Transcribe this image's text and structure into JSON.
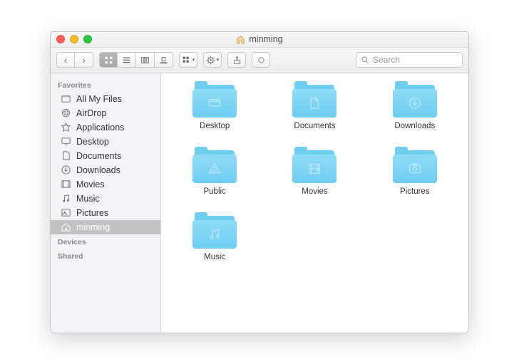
{
  "window": {
    "title": "minming"
  },
  "toolbar": {
    "search_placeholder": "Search"
  },
  "sidebar": {
    "sections": {
      "favorites": {
        "header": "Favorites",
        "items": [
          {
            "label": "All My Files",
            "icon": "all-my-files-icon"
          },
          {
            "label": "AirDrop",
            "icon": "airdrop-icon"
          },
          {
            "label": "Applications",
            "icon": "applications-icon"
          },
          {
            "label": "Desktop",
            "icon": "desktop-icon"
          },
          {
            "label": "Documents",
            "icon": "documents-icon"
          },
          {
            "label": "Downloads",
            "icon": "downloads-icon"
          },
          {
            "label": "Movies",
            "icon": "movies-icon"
          },
          {
            "label": "Music",
            "icon": "music-icon"
          },
          {
            "label": "Pictures",
            "icon": "pictures-icon"
          },
          {
            "label": "minming",
            "icon": "home-icon",
            "selected": true
          }
        ]
      },
      "devices": {
        "header": "Devices"
      },
      "shared": {
        "header": "Shared"
      }
    }
  },
  "content": {
    "items": [
      {
        "label": "Desktop",
        "icon": "desktop"
      },
      {
        "label": "Documents",
        "icon": "document"
      },
      {
        "label": "Downloads",
        "icon": "download"
      },
      {
        "label": "Public",
        "icon": "public"
      },
      {
        "label": "Movies",
        "icon": "movie"
      },
      {
        "label": "Pictures",
        "icon": "picture"
      },
      {
        "label": "Music",
        "icon": "music"
      }
    ]
  }
}
